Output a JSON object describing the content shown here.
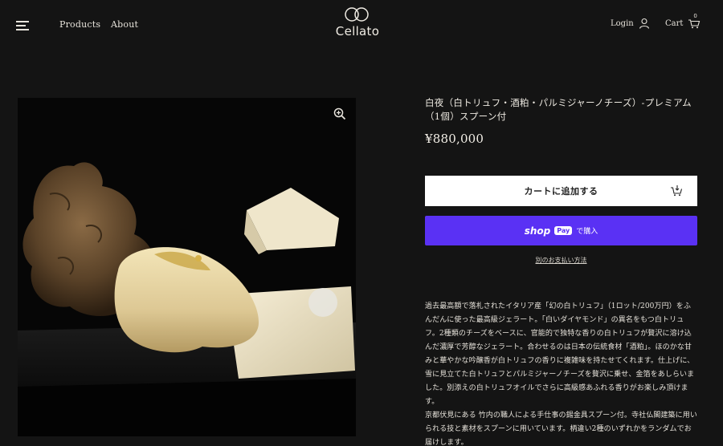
{
  "header": {
    "nav": [
      "Products",
      "About"
    ],
    "logo_text": "Cellato",
    "login_label": "Login",
    "cart_label": "Cart",
    "cart_count": "0"
  },
  "product": {
    "title": "白夜（白トリュフ・酒粕・パルミジャーノチーズ）-プレミアム（1個）スプーン付",
    "price": "¥880,000",
    "add_to_cart_label": "カートに追加する",
    "shoppay_brand": "shop",
    "shoppay_pay": "Pay",
    "shoppay_suffix": "で購入",
    "more_payment_label": "別のお支払い方法",
    "description": [
      "過去最高額で落札されたイタリア産「幻の白トリュフ」（1ロット/200万円）をふんだんに使った最高級ジェラート。「白いダイヤモンド」の異名をもつ白トリュフ。2種類のチーズをベースに、官能的で独特な香りの白トリュフが贅沢に溶け込んだ濃厚で芳醇なジェラート。合わせるのは日本の伝統食材「酒粕」。ほのかな甘みと華やかな吟醸香が白トリュフの香りに複雑味を持たせてくれます。仕上げに、雪に見立てた白トリュフとパルミジャーノチーズを贅沢に乗せ、金箔をあしらいました。別添えの白トリュフオイルでさらに高級感あふれる香りがお楽しみ頂けます。",
      "京都伏見にある 竹内の職人による手仕事の錫金具スプーン付。寺社仏閣建築に用いられる技と素材をスプーンに用いています。柄違い2種のいずれかをランダムでお届けします。"
    ]
  },
  "colors": {
    "background": "#141414",
    "shoppay": "#5a31f4",
    "button_white": "#ffffff"
  }
}
